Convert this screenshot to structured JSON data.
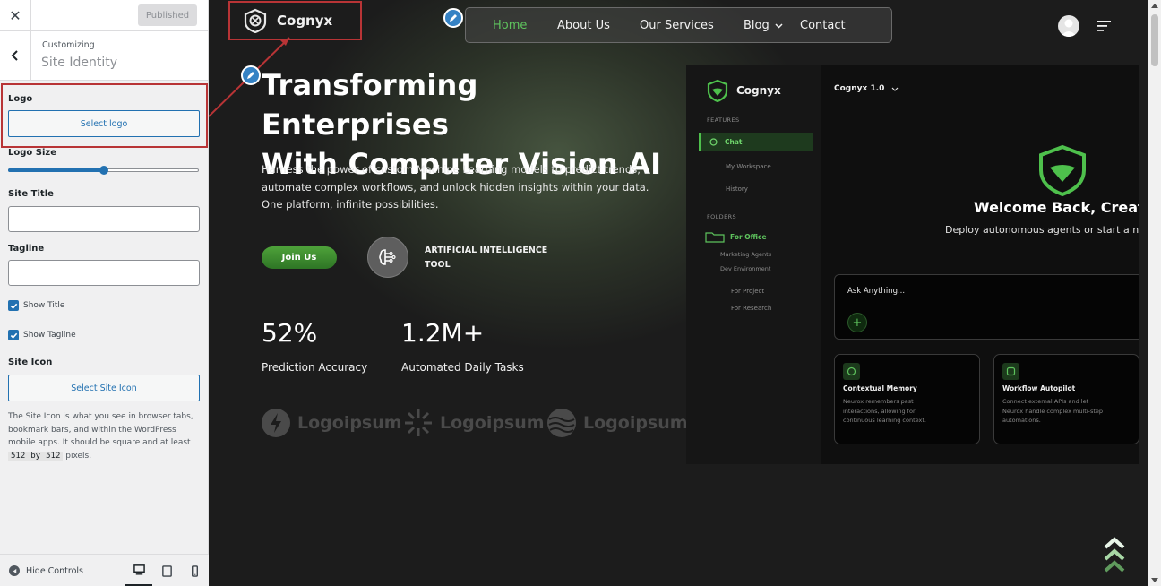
{
  "customizer": {
    "close_icon": "close-icon",
    "publish_label": "Published",
    "header_small": "Customizing",
    "header_title": "Site Identity",
    "logo_label": "Logo",
    "select_logo_label": "Select logo",
    "logo_size_label": "Logo Size",
    "logo_size_value": 0.5,
    "site_title_label": "Site Title",
    "site_title_value": "",
    "tagline_label": "Tagline",
    "tagline_value": "",
    "show_title_label": "Show Title",
    "show_title_checked": true,
    "show_tagline_label": "Show Tagline",
    "show_tagline_checked": true,
    "site_icon_label": "Site Icon",
    "select_site_icon_label": "Select Site Icon",
    "site_icon_desc_1": "The Site Icon is what you see in browser tabs, bookmark bars, and within the WordPress mobile apps. It should be square and at least",
    "site_icon_size_w": "512",
    "site_icon_by": "by",
    "site_icon_size_h": "512",
    "site_icon_desc_2": "pixels.",
    "hide_controls_label": "Hide Controls",
    "accent_color": "#2271b1",
    "highlight_color": "#b83436"
  },
  "site": {
    "brand_name": "Cognyx",
    "nav": [
      {
        "label": "Home",
        "active": true
      },
      {
        "label": "About Us"
      },
      {
        "label": "Our Services"
      },
      {
        "label": "Blog"
      },
      {
        "label": "Contact"
      }
    ],
    "hero_title_line1": "Transforming Enterprises",
    "hero_title_line2": "With Computer Vision AI",
    "hero_desc": "Harness the power of custom Machine Learning models to predict trends, automate complex workflows, and unlock hidden insights within your data. One platform, infinite possibilities.",
    "join_label": "Join Us",
    "ai_label_line1": "ARTIFICIAL INTELLIGENCE",
    "ai_label_line2": "TOOL",
    "stats": [
      {
        "value": "52%",
        "label": "Prediction Accuracy"
      },
      {
        "value": "1.2M+",
        "label": "Automated Daily Tasks"
      }
    ],
    "partners": [
      "Logoipsum",
      "Logoipsum",
      "Logoipsum"
    ],
    "accent_color": "#5ec35d"
  },
  "mockup": {
    "brand": "Cognyx",
    "version": "Cognyx 1.0",
    "features_label": "FEATURES",
    "chat_label": "Chat",
    "workspace_label": "My Workspace",
    "history_label": "History",
    "folders_label": "FOLDERS",
    "for_office_label": "For Office",
    "marketing_label": "Marketing Agents",
    "dev_label": "Dev Environment",
    "for_project_label": "For Project",
    "for_research_label": "For Research",
    "welcome": "Welcome Back, Creato",
    "welcome_sub": "Deploy autonomous agents or start a n",
    "ask_placeholder": "Ask Anything...",
    "cards": [
      {
        "title": "Contextual Memory",
        "desc": "Neurox remembers past interactions, allowing for continuous learning context."
      },
      {
        "title": "Workflow Autopilot",
        "desc": "Connect external APIs and let Neurox handle complex multi-step automations."
      }
    ]
  }
}
